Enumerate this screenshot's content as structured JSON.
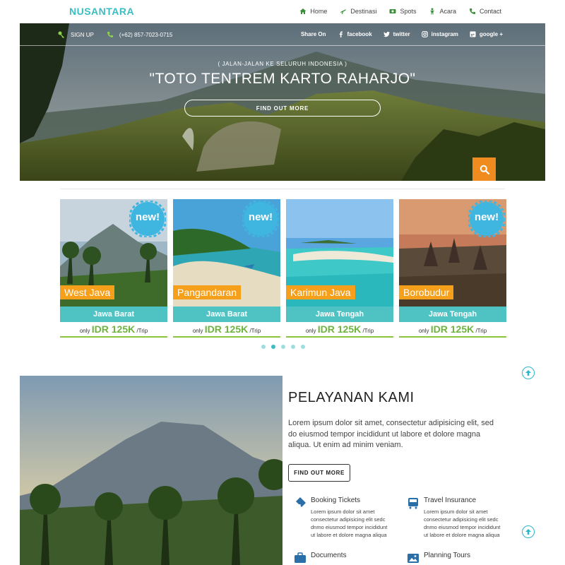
{
  "brand": "NUSANTARA",
  "nav": [
    {
      "label": "Home",
      "icon": "home-icon"
    },
    {
      "label": "Destinasi",
      "icon": "plane-icon"
    },
    {
      "label": "Spots",
      "icon": "money-icon"
    },
    {
      "label": "Acara",
      "icon": "person-icon"
    },
    {
      "label": "Contact",
      "icon": "phone-icon"
    }
  ],
  "hero": {
    "signup": "SIGN UP",
    "phone": "(+62) 857-7023-0715",
    "share_label": "Share On",
    "social": [
      "facebook",
      "twitter",
      "instagram",
      "google +"
    ],
    "subtitle": "( JALAN-JALAN KE SELURUH INDONESIA )",
    "title": "\"TOTO TENTREM KARTO RAHARJO\"",
    "button": "FIND OUT MORE"
  },
  "cards": [
    {
      "name": "West Java",
      "region": "Jawa Barat",
      "prefix": "only",
      "price": "IDR 125K",
      "suffix": "/Trip",
      "badge": "new!"
    },
    {
      "name": "Pangandaran",
      "region": "Jawa Barat",
      "prefix": "only",
      "price": "IDR 125K",
      "suffix": "/Trip",
      "badge": "new!"
    },
    {
      "name": "Karimun Java",
      "region": "Jawa Tengah",
      "prefix": "only",
      "price": "IDR 125K",
      "suffix": "/Trip",
      "badge": ""
    },
    {
      "name": "Borobudur",
      "region": "Jawa Tengah",
      "prefix": "only",
      "price": "IDR 125K",
      "suffix": "/Trip",
      "badge": "new!"
    }
  ],
  "carousel": {
    "dots": 5,
    "active": 1
  },
  "services": {
    "title": "PELAYANAN KAMI",
    "description": "Lorem ipsum dolor sit amet, consectetur adipisicing elit, sed do eiusmod tempor incididunt ut labore et dolore magna aliqua. Ut enim ad minim veniam.",
    "button": "FIND OUT MORE",
    "features": [
      {
        "title": "Booking Tickets",
        "icon": "ticket-icon",
        "text": "Lorem ipsum dolor sit amet consectetur adipisicing elit sedc dnmo eiusmod tempor incididunt ut labore et dolore magna aliqua"
      },
      {
        "title": "Travel Insurance",
        "icon": "bus-icon",
        "text": "Lorem ipsum dolor sit amet consectetur adipisicing elit sedc dnmo eiusmod tempor incididunt ut labore et dolore magna aliqua"
      },
      {
        "title": "Documents",
        "icon": "briefcase-icon",
        "text": ""
      },
      {
        "title": "Planning Tours",
        "icon": "image-icon",
        "text": ""
      }
    ]
  },
  "colors": {
    "accent": "#3bbdc4",
    "orange": "#f59f1b",
    "green": "#6db33f",
    "teal": "#4fc3c3"
  }
}
